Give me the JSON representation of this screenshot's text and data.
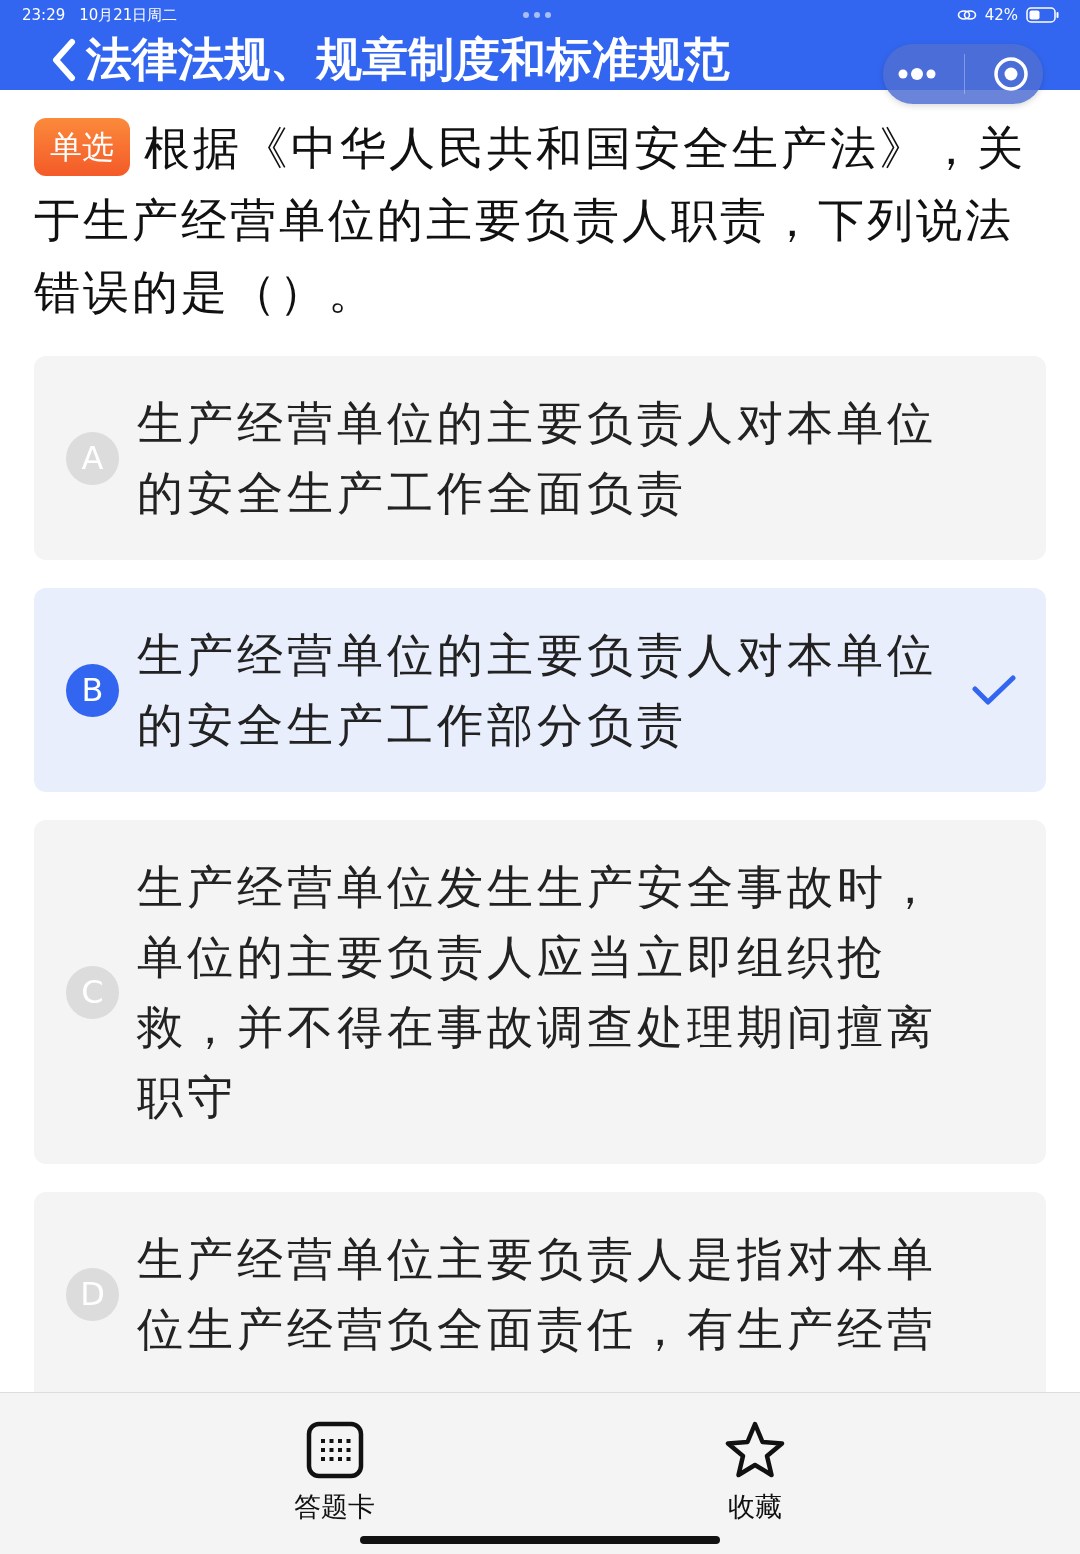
{
  "status_bar": {
    "time": "23:29",
    "date": "10月21日周二",
    "battery": "42%"
  },
  "header": {
    "title": "法律法规、规章制度和标准规范"
  },
  "question": {
    "type_badge": "单选",
    "text": "根据《中华人民共和国安全生产法》，关于生产经营单位的主要负责人职责，下列说法错误的是（）。"
  },
  "options": [
    {
      "letter": "A",
      "text": "生产经营单位的主要负责人对本单位的安全生产工作全面负责",
      "selected": false
    },
    {
      "letter": "B",
      "text": "生产经营单位的主要负责人对本单位的安全生产工作部分负责",
      "selected": true
    },
    {
      "letter": "C",
      "text": "生产经营单位发生生产安全事故时，单位的主要负责人应当立即组织抢救，并不得在事故调查处理期间擅离职守",
      "selected": false
    },
    {
      "letter": "D",
      "text": "生产经营单位主要负责人是指对本单位生产经营负全面责任，有生产经营",
      "selected": false
    }
  ],
  "bottom_bar": [
    {
      "kind": "grid",
      "label": "答题卡"
    },
    {
      "kind": "star",
      "label": "收藏"
    }
  ]
}
